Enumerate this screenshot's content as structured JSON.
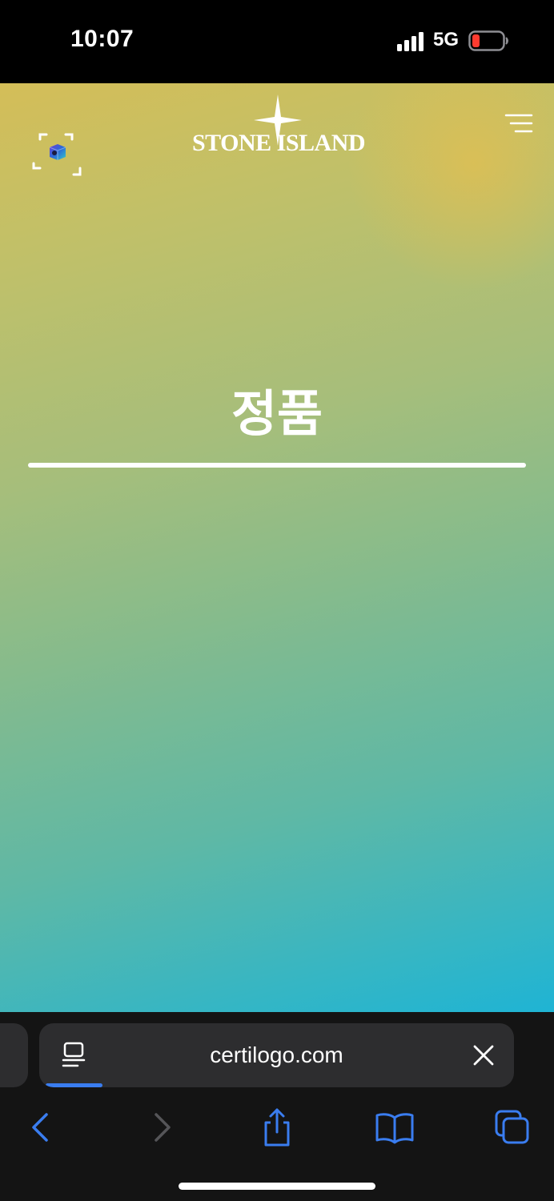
{
  "status_bar": {
    "time": "10:07",
    "network": "5G",
    "icons": [
      "signal-bars-icon",
      "battery-low-icon"
    ]
  },
  "header": {
    "brand": "STONE ISLAND",
    "brand_icon": "compass-rose-star-icon",
    "scan_icon": "scan-frame-icon",
    "menu_icon": "hamburger-menu-icon"
  },
  "main": {
    "title": "정품"
  },
  "safari": {
    "url": "certilogo.com",
    "load_progress": 0.12,
    "reader_icon": "page-menu-icon",
    "clear_icon": "close-icon",
    "toolbar": [
      "back-icon",
      "forward-icon",
      "share-icon",
      "bookmarks-icon",
      "tabs-icon"
    ]
  },
  "colors": {
    "accent": "#3a7df0",
    "gradient_top": "#d4be58",
    "gradient_bottom": "#1fb4d4",
    "battery_low": "#ff3b30"
  }
}
